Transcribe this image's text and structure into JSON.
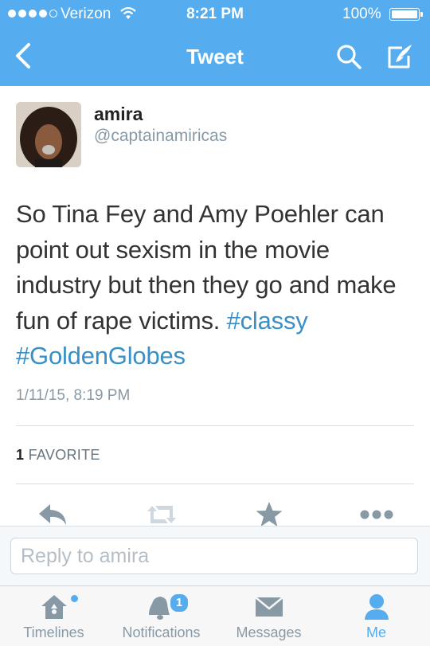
{
  "status_bar": {
    "carrier": "Verizon",
    "time": "8:21 PM",
    "battery": "100%"
  },
  "nav": {
    "title": "Tweet",
    "back_icon": "chevron-left-icon",
    "search_icon": "search-icon",
    "compose_icon": "compose-icon"
  },
  "tweet": {
    "user_name": "amira",
    "user_handle": "@captainamiricas",
    "text": "So Tina Fey and Amy Poehler can point out sexism in the movie industry but then they go and make fun of rape victims. ",
    "hashtags": [
      "#classy",
      "#GoldenGlobes"
    ],
    "timestamp": "1/11/15, 8:19 PM",
    "favorite_count": "1",
    "favorite_label": "FAVORITE"
  },
  "actions": {
    "reply_icon": "reply-icon",
    "retweet_icon": "retweet-icon",
    "favorite_icon": "star-icon",
    "more_icon": "more-icon"
  },
  "reply": {
    "placeholder": "Reply to amira"
  },
  "tabs": [
    {
      "label": "Timelines",
      "icon": "home-icon"
    },
    {
      "label": "Notifications",
      "icon": "bell-icon",
      "badge": "1"
    },
    {
      "label": "Messages",
      "icon": "envelope-icon"
    },
    {
      "label": "Me",
      "icon": "person-icon"
    }
  ],
  "colors": {
    "brand": "#55acee",
    "hashtag": "#3a8fc5",
    "muted": "#8899a6"
  }
}
